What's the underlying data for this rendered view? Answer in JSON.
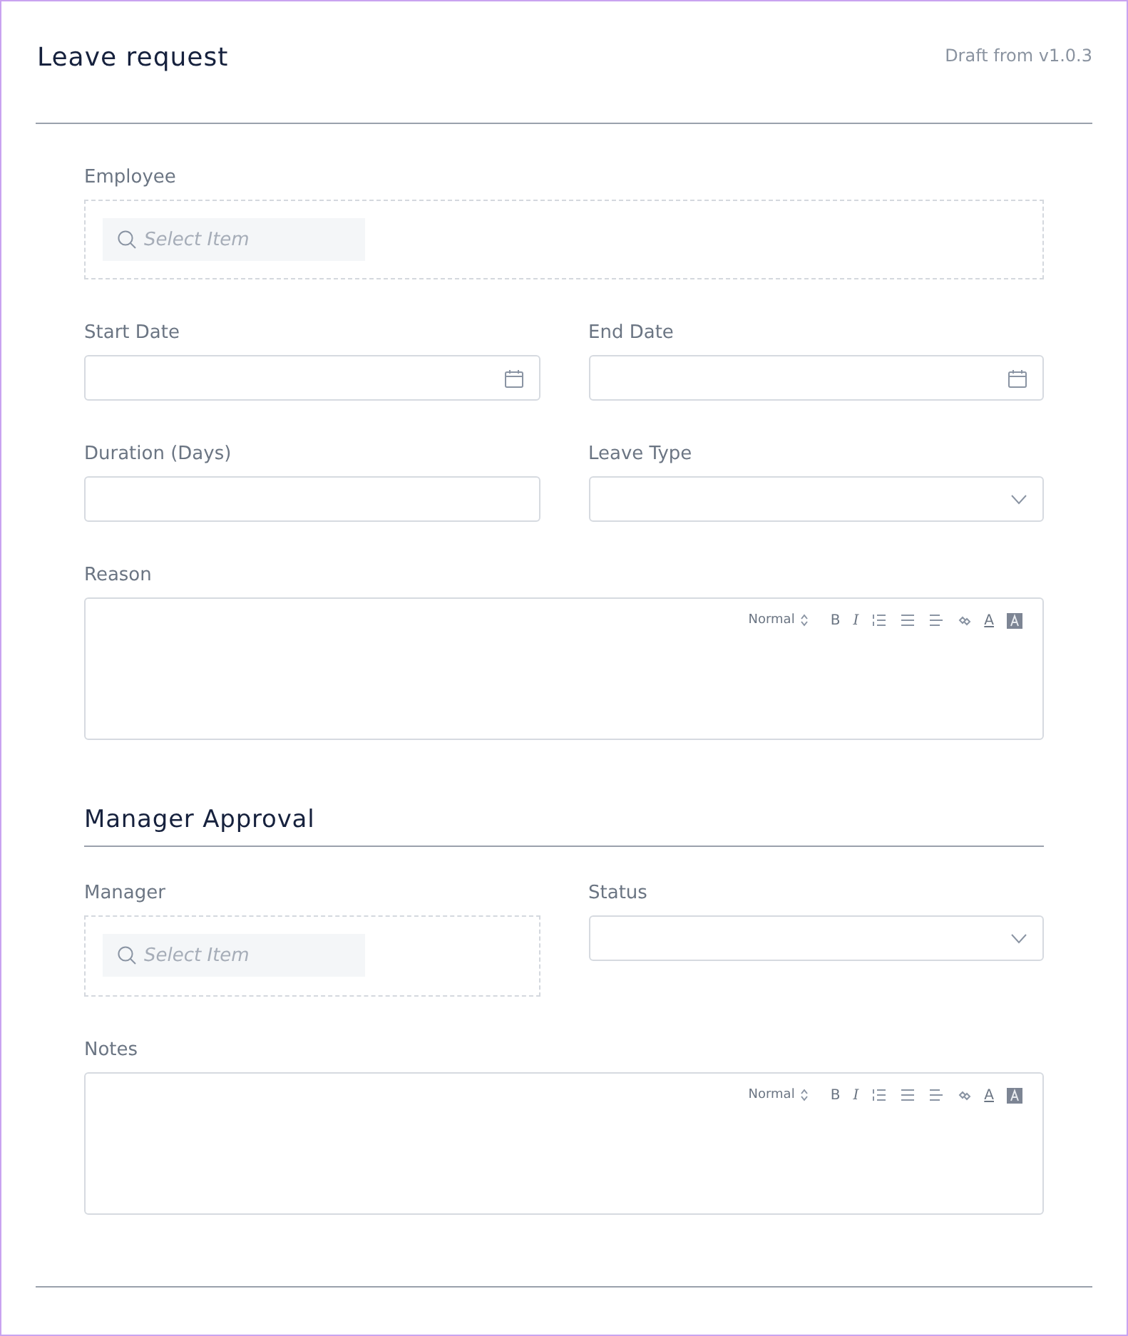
{
  "header": {
    "title": "Leave request",
    "version": "Draft from v1.0.3"
  },
  "sections": [
    {
      "rows": [
        [
          {
            "kind": "lookup",
            "label": "Employee",
            "placeholder": "Select Item"
          }
        ],
        [
          {
            "kind": "date",
            "label": "Start Date"
          },
          {
            "kind": "date",
            "label": "End Date"
          }
        ],
        [
          {
            "kind": "text",
            "label": "Duration (Days)"
          },
          {
            "kind": "select",
            "label": "Leave Type"
          }
        ],
        [
          {
            "kind": "richtext",
            "label": "Reason",
            "toolbar": [
              {
                "kind": "format",
                "label": "Normal"
              },
              {
                "kind": "bold",
                "label": "B"
              },
              {
                "kind": "italic",
                "label": "I"
              },
              {
                "kind": "ordered-list"
              },
              {
                "kind": "bullet-list"
              },
              {
                "kind": "align"
              },
              {
                "kind": "link"
              },
              {
                "kind": "color",
                "label": "A"
              },
              {
                "kind": "background"
              }
            ]
          }
        ]
      ]
    },
    {
      "title": "Manager Approval",
      "rows": [
        [
          {
            "kind": "lookup",
            "label": "Manager",
            "placeholder": "Select Item"
          },
          {
            "kind": "select",
            "label": "Status"
          }
        ],
        [
          {
            "kind": "richtext",
            "label": "Notes",
            "toolbar": [
              {
                "kind": "format",
                "label": "Normal"
              },
              {
                "kind": "bold",
                "label": "B"
              },
              {
                "kind": "italic",
                "label": "I"
              },
              {
                "kind": "ordered-list"
              },
              {
                "kind": "bullet-list"
              },
              {
                "kind": "align"
              },
              {
                "kind": "link"
              },
              {
                "kind": "color",
                "label": "A"
              },
              {
                "kind": "background"
              }
            ]
          }
        ]
      ]
    }
  ]
}
